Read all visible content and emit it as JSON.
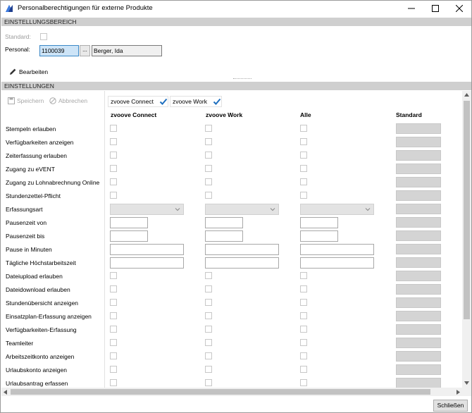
{
  "window": {
    "title": "Personalberechtigungen für externe Produkte"
  },
  "settings_area": {
    "header": "EINSTELLUNGSBEREICH",
    "standard_label": "Standard:",
    "personal_label": "Personal:",
    "personal_id": "1100039",
    "lookup_label": "...",
    "personal_name": "Berger, Ida",
    "edit_label": "Bearbeiten"
  },
  "settings": {
    "header": "EINSTELLUNGEN",
    "save_label": "Speichern",
    "cancel_label": "Abbrechen",
    "products": [
      {
        "name": "zvoove Connect",
        "checked": true
      },
      {
        "name": "zvoove Work",
        "checked": true
      }
    ],
    "columns": [
      "zvoove Connect",
      "zvoove Work",
      "Alle",
      "Standard"
    ],
    "rows": [
      {
        "label": "Stempeln erlauben",
        "kind": "check"
      },
      {
        "label": "Verfügbarkeiten anzeigen",
        "kind": "check"
      },
      {
        "label": "Zeiterfassung erlauben",
        "kind": "check"
      },
      {
        "label": "Zugang zu eVENT",
        "kind": "check"
      },
      {
        "label": "Zugang zu Lohnabrechnung Online",
        "kind": "check"
      },
      {
        "label": "Stundenzettel-Pflicht",
        "kind": "check"
      },
      {
        "label": "Erfassungsart",
        "kind": "combo"
      },
      {
        "label": "Pausenzeit von",
        "kind": "short"
      },
      {
        "label": "Pausenzeit bis",
        "kind": "short"
      },
      {
        "label": "Pause in Minuten",
        "kind": "long"
      },
      {
        "label": "Tägliche Höchstarbeitszeit",
        "kind": "long"
      },
      {
        "label": "Dateiupload erlauben",
        "kind": "check"
      },
      {
        "label": "Dateidownload erlauben",
        "kind": "check"
      },
      {
        "label": "Stundenübersicht anzeigen",
        "kind": "check"
      },
      {
        "label": "Einsatzplan-Erfassung anzeigen",
        "kind": "check"
      },
      {
        "label": "Verfügbarkeiten-Erfassung",
        "kind": "check"
      },
      {
        "label": "Teamleiter",
        "kind": "check"
      },
      {
        "label": "Arbeitszeitkonto anzeigen",
        "kind": "check"
      },
      {
        "label": "Urlaubskonto anzeigen",
        "kind": "check"
      },
      {
        "label": "Urlaubsantrag erfassen",
        "kind": "check"
      }
    ]
  },
  "footer": {
    "close_label": "Schließen"
  },
  "colors": {
    "accent": "#1e6fbf",
    "section_header": "#cfcfcf",
    "selected_field": "#cde4f7"
  }
}
